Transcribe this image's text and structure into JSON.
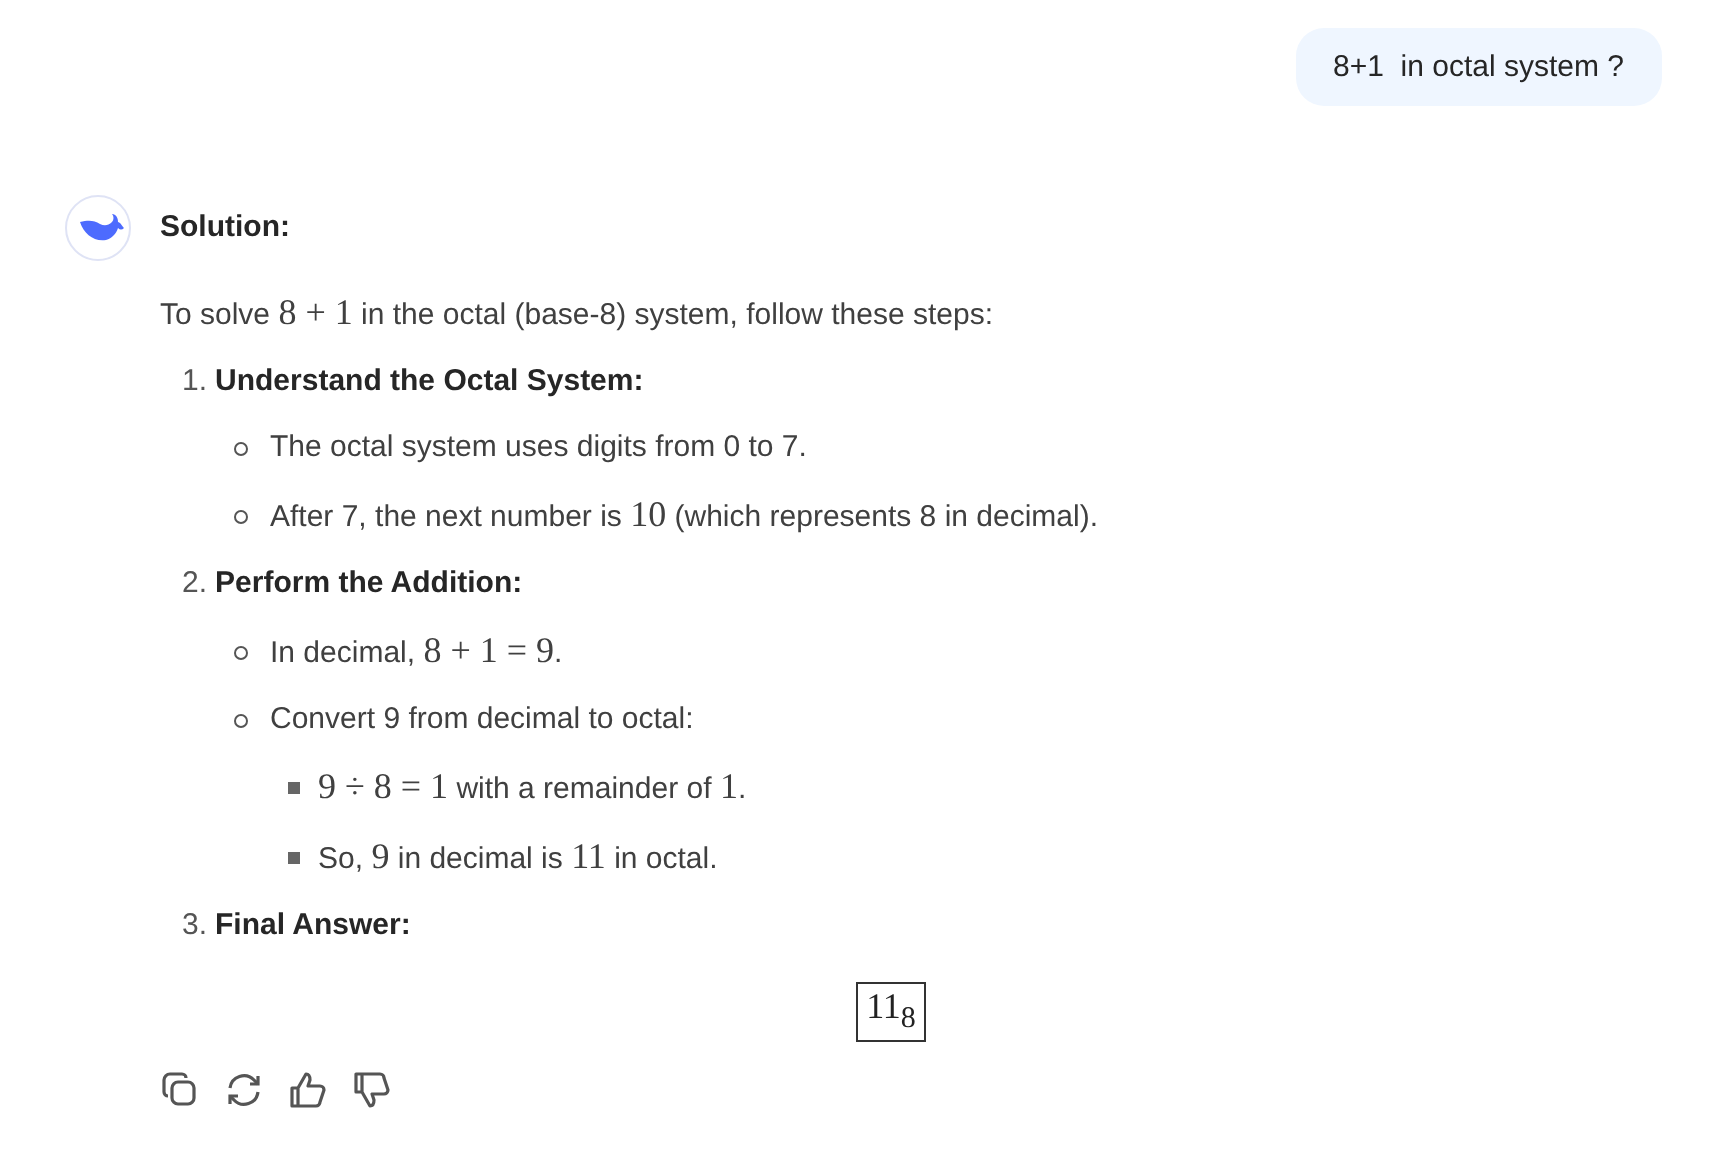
{
  "user_message": "8+1  in octal system ?",
  "reply": {
    "heading": "Solution:",
    "intro": [
      {
        "kind": "text",
        "text": "To solve "
      },
      {
        "kind": "math",
        "text": "8 + 1"
      },
      {
        "kind": "text",
        "text": " in the octal (base-8) system, follow these steps:"
      }
    ],
    "steps": [
      {
        "number": "1.",
        "title": "Understand the Octal System:",
        "points": [
          {
            "parts": [
              {
                "kind": "text",
                "text": "The octal system uses digits from 0 to 7."
              }
            ]
          },
          {
            "parts": [
              {
                "kind": "text",
                "text": "After 7, the next number is "
              },
              {
                "kind": "math",
                "text": "10"
              },
              {
                "kind": "text",
                "text": " (which represents 8 in decimal)."
              }
            ]
          }
        ]
      },
      {
        "number": "2.",
        "title": "Perform the Addition:",
        "points": [
          {
            "parts": [
              {
                "kind": "text",
                "text": "In decimal, "
              },
              {
                "kind": "math",
                "text": "8 + 1 = 9"
              },
              {
                "kind": "text",
                "text": "."
              }
            ]
          },
          {
            "parts": [
              {
                "kind": "text",
                "text": "Convert 9 from decimal to octal:"
              }
            ],
            "children": [
              {
                "parts": [
                  {
                    "kind": "math",
                    "text": "9 ÷ 8 = 1"
                  },
                  {
                    "kind": "text",
                    "text": " with a remainder of "
                  },
                  {
                    "kind": "math",
                    "text": "1"
                  },
                  {
                    "kind": "text",
                    "text": "."
                  }
                ]
              },
              {
                "parts": [
                  {
                    "kind": "text",
                    "text": "So, "
                  },
                  {
                    "kind": "math",
                    "text": "9"
                  },
                  {
                    "kind": "text",
                    "text": " in decimal is "
                  },
                  {
                    "kind": "math",
                    "text": "11"
                  },
                  {
                    "kind": "text",
                    "text": " in octal."
                  }
                ]
              }
            ]
          }
        ]
      },
      {
        "number": "3.",
        "title": "Final Answer:"
      }
    ],
    "answer": "11$_{8}$"
  },
  "actions": [
    {
      "kind": "copy"
    },
    {
      "kind": "regenerate"
    },
    {
      "kind": "like"
    },
    {
      "kind": "dislike"
    }
  ]
}
